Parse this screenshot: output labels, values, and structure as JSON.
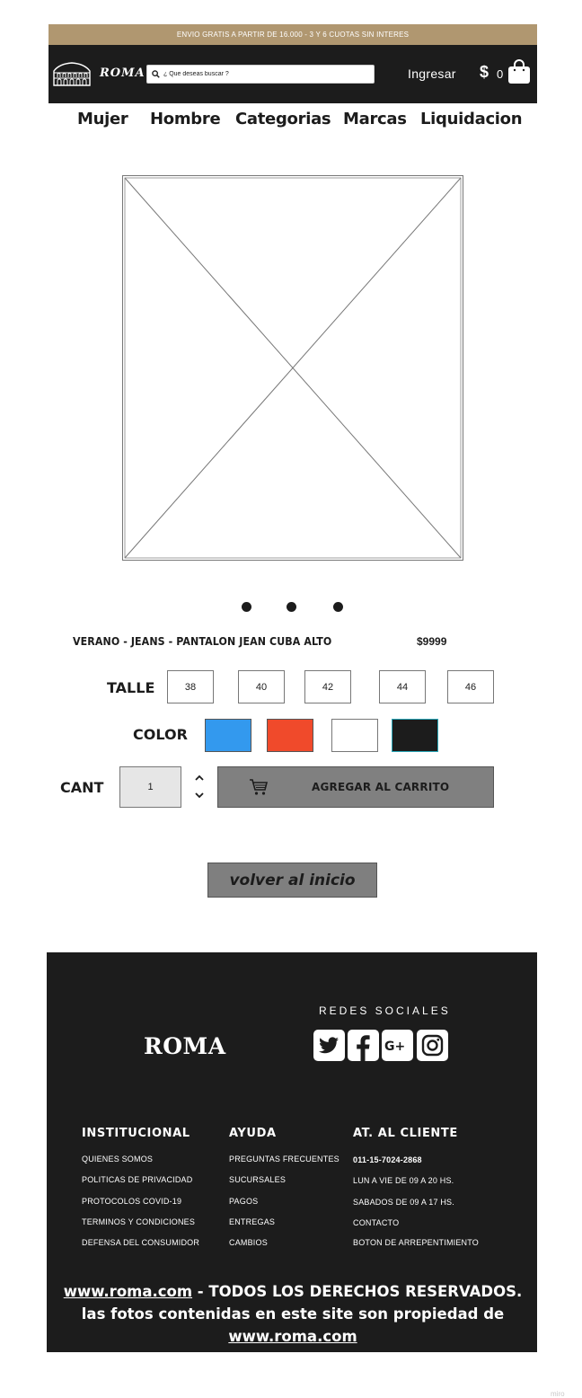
{
  "banner": {
    "text": "ENVIO GRATIS A PARTIR DE 16.000 - 3 Y 6 CUOTAS SIN INTERES"
  },
  "header": {
    "logo_text": "ROMA",
    "search_placeholder": "¿ Que deseas buscar ?",
    "login_label": "Ingresar",
    "cart_currency": "$",
    "cart_count": "0"
  },
  "nav": {
    "items": [
      "Mujer",
      "Hombre",
      "Categorias",
      "Marcas",
      "Liquidacion"
    ]
  },
  "product": {
    "title": "VERANO - JEANS - PANTALON JEAN CUBA ALTO",
    "price": "$9999"
  },
  "size": {
    "label": "TALLE",
    "options": [
      "38",
      "40",
      "42",
      "44",
      "46"
    ]
  },
  "color": {
    "label": "COLOR",
    "options": [
      "#3399ee",
      "#f04a2b",
      "#ffffff",
      "#1c1c1c"
    ]
  },
  "quantity": {
    "label": "CANT",
    "value": "1"
  },
  "add_to_cart": {
    "label": "AGREGAR AL CARRITO"
  },
  "back_home": {
    "label": "volver al inicio"
  },
  "footer": {
    "logo": "ROMA",
    "social_title": "REDES SOCIALES",
    "social_icons": [
      "twitter-icon",
      "facebook-icon",
      "google-plus-icon",
      "instagram-icon"
    ],
    "columns": [
      {
        "title": "INSTITUCIONAL",
        "links": [
          "QUIENES SOMOS",
          "POLITICAS DE PRIVACIDAD",
          "PROTOCOLOS COVID-19",
          "TERMINOS Y CONDICIONES",
          "DEFENSA DEL CONSUMIDOR"
        ]
      },
      {
        "title": "AYUDA",
        "links": [
          "PREGUNTAS FRECUENTES",
          "SUCURSALES",
          "PAGOS",
          "ENTREGAS",
          "CAMBIOS"
        ]
      },
      {
        "title": "AT. AL CLIENTE",
        "links": [
          "011-15-7024-2868",
          "LUN A VIE DE 09 A 20 HS.",
          "SABADOS DE 09 A 17 HS.",
          "CONTACTO",
          "BOTON DE ARREPENTIMIENTO"
        ]
      }
    ],
    "copyright_link": "www.roma.com",
    "copyright_text": " - TODOS LOS DERECHOS RESERVADOS. las fotos contenidas en este site son propiedad de ",
    "copyright_link2": "www.roma.com"
  },
  "watermark": "miro"
}
